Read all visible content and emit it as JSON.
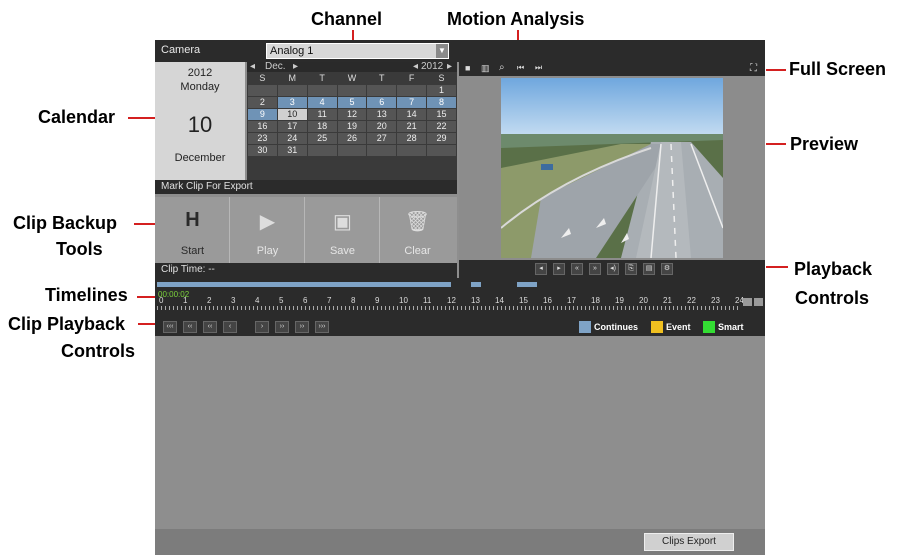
{
  "callouts": {
    "channel": "Channel",
    "motion_analysis": "Motion Analysis",
    "full_screen": "Full Screen",
    "calendar": "Calendar",
    "preview": "Preview",
    "clip_backup_tools_1": "Clip Backup",
    "clip_backup_tools_2": "Tools",
    "playback_controls_1": "Playback",
    "playback_controls_2": "Controls",
    "timelines": "Timelines",
    "clip_playback_controls_1": "Clip Playback",
    "clip_playback_controls_2": "Controls"
  },
  "camera": {
    "label": "Camera",
    "value": "Analog 1"
  },
  "date": {
    "year": "2012",
    "weekday": "Monday",
    "day": "10",
    "month": "December"
  },
  "calendar": {
    "month": "Dec.",
    "year": "2012",
    "weekdays": [
      "S",
      "M",
      "T",
      "W",
      "T",
      "F",
      "S"
    ],
    "rows": [
      [
        "",
        "",
        "",
        "",
        "",
        "",
        "1"
      ],
      [
        "2",
        "3",
        "4",
        "5",
        "6",
        "7",
        "8"
      ],
      [
        "9",
        "10",
        "11",
        "12",
        "13",
        "14",
        "15"
      ],
      [
        "16",
        "17",
        "18",
        "19",
        "20",
        "21",
        "22"
      ],
      [
        "23",
        "24",
        "25",
        "26",
        "27",
        "28",
        "29"
      ],
      [
        "30",
        "31",
        "",
        "",
        "",
        "",
        ""
      ]
    ],
    "marked_days": [
      "3",
      "4",
      "5",
      "6",
      "7",
      "8",
      "9"
    ],
    "selected_day": "10"
  },
  "mark_clip": {
    "title": "Mark Clip For Export"
  },
  "tools": [
    {
      "label": "Start",
      "icon": "mark-start-icon"
    },
    {
      "label": "Play",
      "icon": "play-icon"
    },
    {
      "label": "Save",
      "icon": "save-icon"
    },
    {
      "label": "Clear",
      "icon": "trash-icon"
    }
  ],
  "clip_time": {
    "label": "Clip Time: --"
  },
  "timeline": {
    "current_time": "00:00:02",
    "hours": [
      "0",
      "1",
      "2",
      "3",
      "4",
      "5",
      "6",
      "7",
      "8",
      "9",
      "10",
      "11",
      "12",
      "13",
      "14",
      "15",
      "16",
      "17",
      "18",
      "19",
      "20",
      "21",
      "22",
      "23",
      "24"
    ]
  },
  "legend": [
    {
      "label": "Continues",
      "color": "#7fa3c6"
    },
    {
      "label": "Event",
      "color": "#f0c020"
    },
    {
      "label": "Smart",
      "color": "#33dd33"
    }
  ],
  "export": {
    "label": "Clips Export"
  },
  "colors": {
    "callout_line": "#d42020",
    "recording": "#7fa3c6"
  }
}
